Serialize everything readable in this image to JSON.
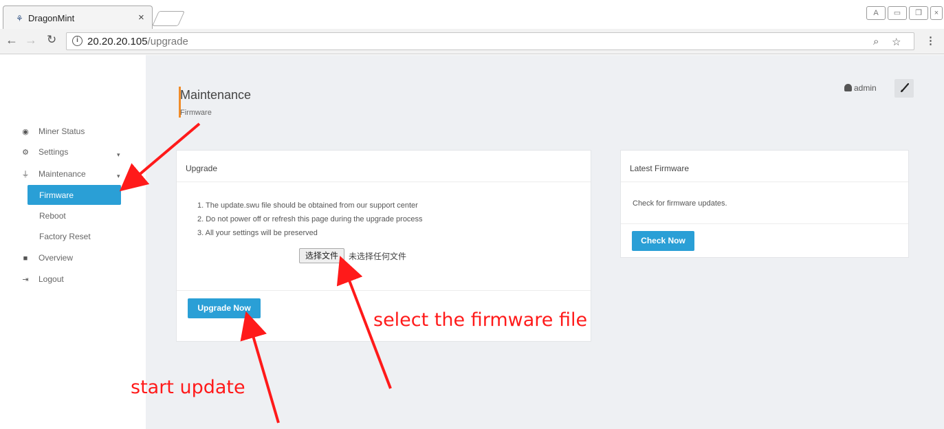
{
  "browser": {
    "tab_title": "DragonMint",
    "tab_close": "×",
    "url_host": "20.20.20.105",
    "url_path": "/upgrade"
  },
  "sidebar": {
    "items": [
      {
        "label": "Miner Status",
        "icon": "dashboard-icon"
      },
      {
        "label": "Settings",
        "icon": "cogs-icon"
      },
      {
        "label": "Maintenance",
        "icon": "plug-icon"
      },
      {
        "label": "Overview",
        "icon": "book-icon"
      },
      {
        "label": "Logout",
        "icon": "sign-out-icon"
      }
    ],
    "submenu": [
      "Firmware",
      "Reboot",
      "Factory Reset"
    ],
    "active": "Firmware"
  },
  "header": {
    "title": "Maintenance",
    "subtitle": "Firmware",
    "user": "admin"
  },
  "upgrade_panel": {
    "title": "Upgrade",
    "instructions": [
      "1. The update.swu file should be obtained from our support center",
      "2. Do not power off or refresh this page during the upgrade process",
      "3. All your settings will be preserved"
    ],
    "file_button": "选择文件",
    "file_status": "未选择任何文件",
    "button": "Upgrade Now"
  },
  "firmware_panel": {
    "title": "Latest Firmware",
    "text": "Check for firmware updates.",
    "button": "Check Now"
  },
  "annotations": {
    "select": "select the firmware file",
    "start": "start update"
  },
  "colors": {
    "accent": "#2a9fd6",
    "title_bar": "#f08c2a",
    "annotation": "#ff1a1a"
  }
}
